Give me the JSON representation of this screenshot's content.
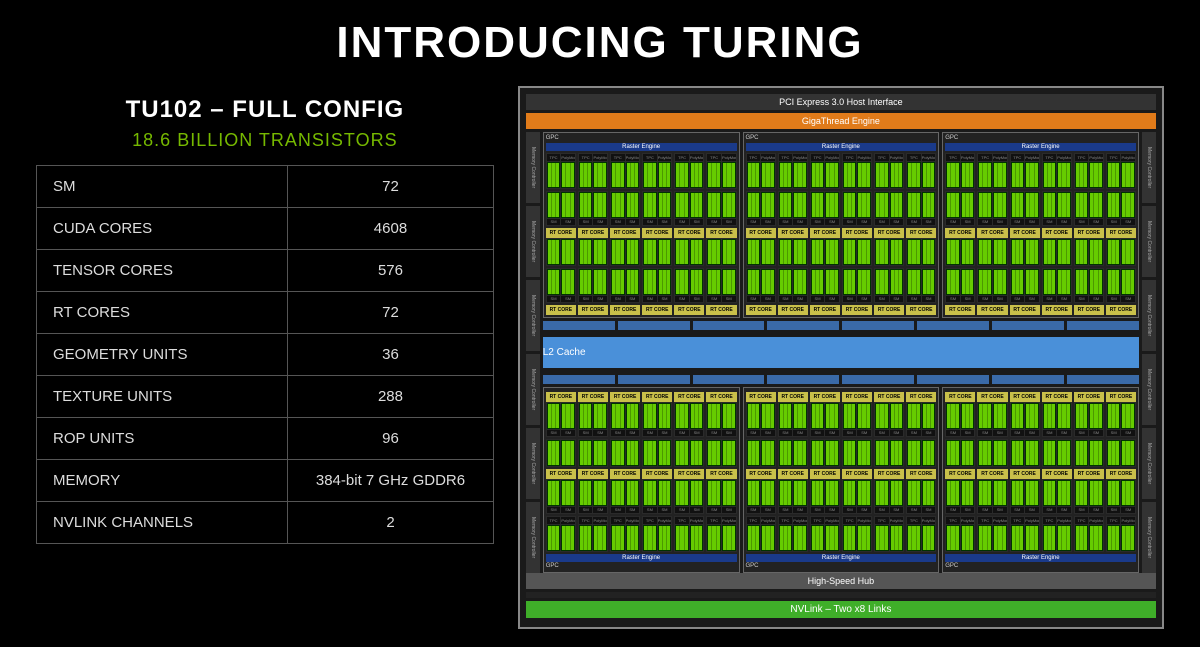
{
  "title": "INTRODUCING TURING",
  "config": {
    "name": "TU102 – FULL CONFIG",
    "subtitle": "18.6 BILLION TRANSISTORS",
    "rows": [
      {
        "label": "SM",
        "value": "72"
      },
      {
        "label": "CUDA CORES",
        "value": "4608"
      },
      {
        "label": "TENSOR CORES",
        "value": "576"
      },
      {
        "label": "RT CORES",
        "value": "72"
      },
      {
        "label": "GEOMETRY UNITS",
        "value": "36"
      },
      {
        "label": "TEXTURE UNITS",
        "value": "288"
      },
      {
        "label": "ROP UNITS",
        "value": "96"
      },
      {
        "label": "MEMORY",
        "value": "384-bit 7 GHz GDDR6"
      },
      {
        "label": "NVLINK CHANNELS",
        "value": "2"
      }
    ]
  },
  "diagram": {
    "pci": "PCI Express 3.0 Host Interface",
    "giga": "GigaThread Engine",
    "gpc": "GPC",
    "raster": "Raster Engine",
    "tpc": "TPC",
    "polymorph": "PolyMorph Engine",
    "sm": "SM",
    "rt": "RT CORE",
    "l2": "L2 Cache",
    "hub": "High-Speed Hub",
    "nvlink": "NVLink – Two x8 Links",
    "memctrl": "Memory Controller",
    "gpc_count": 6,
    "tpc_per_gpc": 6,
    "sm_per_tpc": 2,
    "mem_controllers_per_side": 6
  }
}
